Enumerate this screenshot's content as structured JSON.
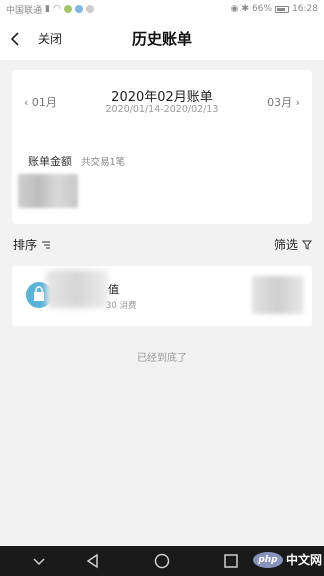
{
  "status_bar": {
    "carrier": "中国联通",
    "battery": "66%",
    "time": "16:28"
  },
  "header": {
    "close_label": "关闭",
    "title": "历史账单"
  },
  "bill": {
    "prev_month": "01月",
    "next_month": "03月",
    "month_title": "2020年02月账单",
    "date_range": "2020/01/14-2020/02/13",
    "amount_label": "账单金额",
    "trade_count": "共交易1笔"
  },
  "controls": {
    "sort_label": "排序",
    "filter_label": "筛选"
  },
  "transaction": {
    "name_visible": "值",
    "sub_visible": "30  消费"
  },
  "footer": {
    "end_text": "已经到底了"
  },
  "watermark": {
    "logo": "php",
    "text": "中文网"
  },
  "colors": {
    "icon_blue": "#5bb3d8",
    "nav_bg": "#1a1a1a",
    "page_bg": "#f2f2f2"
  }
}
